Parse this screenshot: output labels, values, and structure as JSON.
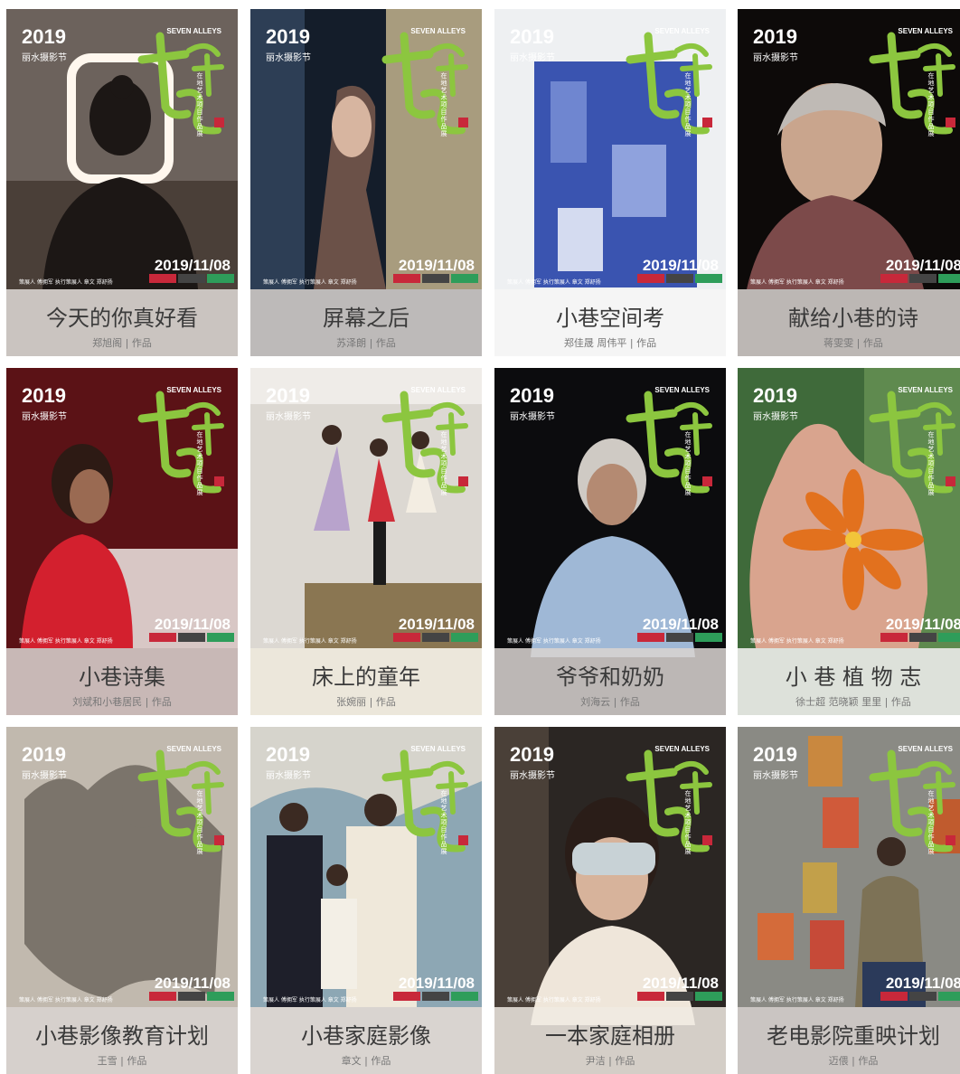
{
  "posters": [
    {
      "year": "2019",
      "festival": "丽水摄影节",
      "english": "SEVEN ALLEYS",
      "vertical": "在地艺术项目作品展",
      "date": "2019/11/08",
      "credits": "策展人 傅拥军 执行策展人 章文 郑舒扬",
      "title": "今天的你真好看",
      "author": "郑旭阁 | 作品"
    },
    {
      "year": "2019",
      "festival": "丽水摄影节",
      "english": "SEVEN ALLEYS",
      "vertical": "在地艺术项目作品展",
      "date": "2019/11/08",
      "credits": "策展人 傅拥军 执行策展人 章文 郑舒扬",
      "title": "屏幕之后",
      "author": "苏泽朗 | 作品"
    },
    {
      "year": "2019",
      "festival": "丽水摄影节",
      "english": "SEVEN ALLEYS",
      "vertical": "在地艺术项目作品展",
      "date": "2019/11/08",
      "credits": "策展人 傅拥军 执行策展人 章文 郑舒扬",
      "title": "小巷空间考",
      "author": "郑佳晟 周伟平 | 作品"
    },
    {
      "year": "2019",
      "festival": "丽水摄影节",
      "english": "SEVEN ALLEYS",
      "vertical": "在地艺术项目作品展",
      "date": "2019/11/08",
      "credits": "策展人 傅拥军 执行策展人 章文 郑舒扬",
      "title": "献给小巷的诗",
      "author": "蒋雯雯 | 作品"
    },
    {
      "year": "2019",
      "festival": "丽水摄影节",
      "english": "SEVEN ALLEYS",
      "vertical": "在地艺术项目作品展",
      "date": "2019/11/08",
      "credits": "策展人 傅拥军 执行策展人 章文 郑舒扬",
      "title": "小巷诗集",
      "author": "刘斌和小巷居民 | 作品"
    },
    {
      "year": "2019",
      "festival": "丽水摄影节",
      "english": "SEVEN ALLEYS",
      "vertical": "在地艺术项目作品展",
      "date": "2019/11/08",
      "credits": "策展人 傅拥军 执行策展人 章文 郑舒扬",
      "title": "床上的童年",
      "author": "张婉丽 | 作品"
    },
    {
      "year": "2019",
      "festival": "丽水摄影节",
      "english": "SEVEN ALLEYS",
      "vertical": "在地艺术项目作品展",
      "date": "2019/11/08",
      "credits": "策展人 傅拥军 执行策展人 章文 郑舒扬",
      "title": "爷爷和奶奶",
      "author": "刘海云 | 作品"
    },
    {
      "year": "2019",
      "festival": "丽水摄影节",
      "english": "SEVEN ALLEYS",
      "vertical": "在地艺术项目作品展",
      "date": "2019/11/08",
      "credits": "策展人 傅拥军 执行策展人 章文 郑舒扬",
      "title": "小 巷 植 物 志",
      "author": "徐士超 范晓颖 里里 | 作品"
    },
    {
      "year": "2019",
      "festival": "丽水摄影节",
      "english": "SEVEN ALLEYS",
      "vertical": "在地艺术项目作品展",
      "date": "2019/11/08",
      "credits": "策展人 傅拥军 执行策展人 章文 郑舒扬",
      "title": "小巷影像教育计划",
      "author": "王雪 | 作品"
    },
    {
      "year": "2019",
      "festival": "丽水摄影节",
      "english": "SEVEN ALLEYS",
      "vertical": "在地艺术项目作品展",
      "date": "2019/11/08",
      "credits": "策展人 傅拥军 执行策展人 章文 郑舒扬",
      "title": "小巷家庭影像",
      "author": "章文 | 作品"
    },
    {
      "year": "2019",
      "festival": "丽水摄影节",
      "english": "SEVEN ALLEYS",
      "vertical": "在地艺术项目作品展",
      "date": "2019/11/08",
      "credits": "策展人 傅拥军 执行策展人 章文 郑舒扬",
      "title": "一本家庭相册",
      "author": "尹洁 | 作品"
    },
    {
      "year": "2019",
      "festival": "丽水摄影节",
      "english": "SEVEN ALLEYS",
      "vertical": "在地艺术项目作品展",
      "date": "2019/11/08",
      "credits": "策展人 傅拥军 执行策展人 章文 郑舒扬",
      "title": "老电影院重映计划",
      "author": "迈偎 | 作品"
    }
  ],
  "palette": {
    "logo_green": "#8cc63f",
    "seal_red": "#c8283a",
    "badge_green": "#2e9d5a",
    "band": "#dad4d0"
  }
}
